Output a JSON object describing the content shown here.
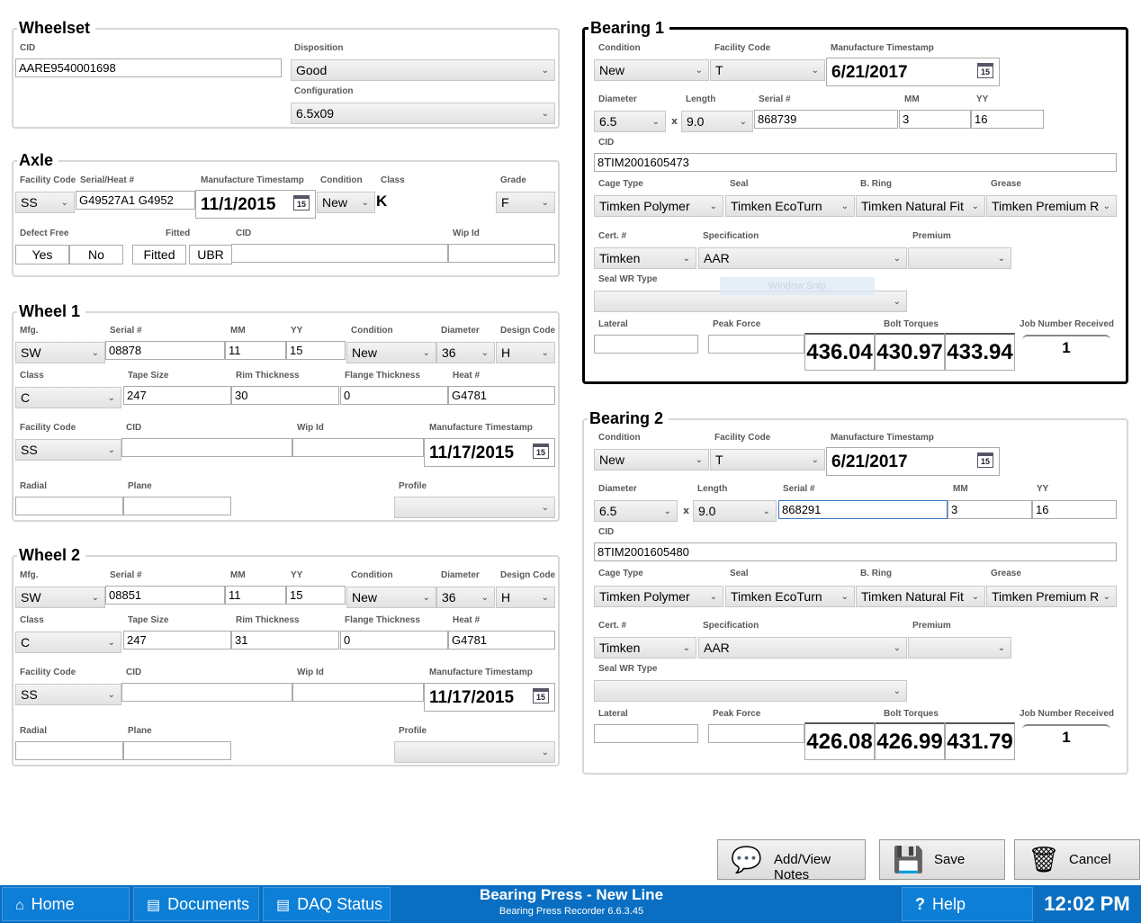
{
  "wheelset": {
    "title": "Wheelset",
    "cid_label": "CID",
    "cid": "AARE9540001698",
    "disposition_label": "Disposition",
    "disposition": "Good",
    "configuration_label": "Configuration",
    "configuration": "6.5x09"
  },
  "axle": {
    "title": "Axle",
    "facility_label": "Facility Code",
    "facility": "SS",
    "serial_label": "Serial/Heat #",
    "serial": "G49527A1 G4952",
    "mfg_ts_label": "Manufacture Timestamp",
    "mfg_ts": "11/1/2015",
    "condition_label": "Condition",
    "condition": "New",
    "class_label": "Class",
    "class_value": "K",
    "grade_label": "Grade",
    "grade": "F",
    "defect_label": "Defect Free",
    "yes": "Yes",
    "no": "No",
    "fitted_label": "Fitted",
    "fitted": "Fitted",
    "ubr": "UBR",
    "cid_label": "CID",
    "cid": "",
    "wip_label": "Wip Id",
    "wip": ""
  },
  "wheel1": {
    "title": "Wheel 1",
    "mfg_label": "Mfg.",
    "mfg": "SW",
    "serial_label": "Serial #",
    "serial": "08878",
    "mm_label": "MM",
    "mm": "11",
    "yy_label": "YY",
    "yy": "15",
    "condition_label": "Condition",
    "condition": "New",
    "diameter_label": "Diameter",
    "diameter": "36",
    "design_label": "Design Code",
    "design": "H",
    "class_label": "Class",
    "class_value": "C",
    "tape_label": "Tape Size",
    "tape": "247",
    "rim_label": "Rim Thickness",
    "rim": "30",
    "flange_label": "Flange Thickness",
    "flange": "0",
    "heat_label": "Heat #",
    "heat": "G4781",
    "facility_label": "Facility Code",
    "facility": "SS",
    "cid_label": "CID",
    "cid": "",
    "wip_label": "Wip Id",
    "wip": "",
    "mfg_ts_label": "Manufacture Timestamp",
    "mfg_ts": "11/17/2015",
    "radial_label": "Radial",
    "plane_label": "Plane",
    "profile_label": "Profile"
  },
  "wheel2": {
    "title": "Wheel 2",
    "mfg_label": "Mfg.",
    "mfg": "SW",
    "serial_label": "Serial #",
    "serial": "08851",
    "mm_label": "MM",
    "mm": "11",
    "yy_label": "YY",
    "yy": "15",
    "condition_label": "Condition",
    "condition": "New",
    "diameter_label": "Diameter",
    "diameter": "36",
    "design_label": "Design Code",
    "design": "H",
    "class_label": "Class",
    "class_value": "C",
    "tape_label": "Tape Size",
    "tape": "247",
    "rim_label": "Rim Thickness",
    "rim": "31",
    "flange_label": "Flange Thickness",
    "flange": "0",
    "heat_label": "Heat #",
    "heat": "G4781",
    "facility_label": "Facility Code",
    "facility": "SS",
    "cid_label": "CID",
    "cid": "",
    "wip_label": "Wip Id",
    "wip": "",
    "mfg_ts_label": "Manufacture Timestamp",
    "mfg_ts": "11/17/2015",
    "radial_label": "Radial",
    "plane_label": "Plane",
    "profile_label": "Profile"
  },
  "bearing1": {
    "title": "Bearing 1",
    "condition_label": "Condition",
    "condition": "New",
    "facility_label": "Facility Code",
    "facility": "T",
    "mfg_ts_label": "Manufacture Timestamp",
    "mfg_ts": "6/21/2017",
    "diameter_label": "Diameter",
    "diameter": "6.5",
    "x": "x",
    "length_label": "Length",
    "length": "9.0",
    "serial_label": "Serial #",
    "serial": "868739",
    "mm_label": "MM",
    "mm": "3",
    "yy_label": "YY",
    "yy": "16",
    "cid_label": "CID",
    "cid": "8TIM2001605473",
    "cage_label": "Cage Type",
    "cage": "Timken Polymer",
    "seal_label": "Seal",
    "seal": "Timken EcoTurn",
    "bring_label": "B. Ring",
    "bring": "Timken Natural Fit",
    "grease_label": "Grease",
    "grease": "Timken Premium R",
    "cert_label": "Cert. #",
    "cert": "Timken",
    "spec_label": "Specification",
    "spec": "AAR",
    "premium_label": "Premium",
    "premium": "",
    "sealwr_label": "Seal WR Type",
    "sealwr": "",
    "lateral_label": "Lateral",
    "peak_label": "Peak Force",
    "bolt_label": "Bolt Torques",
    "bolt1": "436.04",
    "bolt2": "430.97",
    "bolt3": "433.94",
    "job_label": "Job Number Received",
    "job": "1",
    "overlay": "Window Snip"
  },
  "bearing2": {
    "title": "Bearing 2",
    "condition_label": "Condition",
    "condition": "New",
    "facility_label": "Facility Code",
    "facility": "T",
    "mfg_ts_label": "Manufacture Timestamp",
    "mfg_ts": "6/21/2017",
    "diameter_label": "Diameter",
    "diameter": "6.5",
    "x": "x",
    "length_label": "Length",
    "length": "9.0",
    "serial_label": "Serial #",
    "serial": "868291",
    "mm_label": "MM",
    "mm": "3",
    "yy_label": "YY",
    "yy": "16",
    "cid_label": "CID",
    "cid": "8TIM2001605480",
    "cage_label": "Cage Type",
    "cage": "Timken Polymer",
    "seal_label": "Seal",
    "seal": "Timken EcoTurn",
    "bring_label": "B. Ring",
    "bring": "Timken Natural Fit",
    "grease_label": "Grease",
    "grease": "Timken Premium R",
    "cert_label": "Cert. #",
    "cert": "Timken",
    "spec_label": "Specification",
    "spec": "AAR",
    "premium_label": "Premium",
    "premium": "",
    "sealwr_label": "Seal WR Type",
    "sealwr": "",
    "lateral_label": "Lateral",
    "peak_label": "Peak Force",
    "bolt_label": "Bolt Torques",
    "bolt1": "426.08",
    "bolt2": "426.99",
    "bolt3": "431.79",
    "job_label": "Job Number Received",
    "job": "1"
  },
  "actions": {
    "notes": "Add/View Notes",
    "save": "Save",
    "cancel": "Cancel"
  },
  "taskbar": {
    "home": "Home",
    "documents": "Documents",
    "daq": "DAQ Status",
    "app_title": "Bearing Press - New Line",
    "app_version": "Bearing Press Recorder 6.6.3.45",
    "help": "Help",
    "clock": "12:02 PM"
  },
  "colors": {
    "taskbar": "#0a6fc2",
    "accent": "#0d7fd6"
  }
}
